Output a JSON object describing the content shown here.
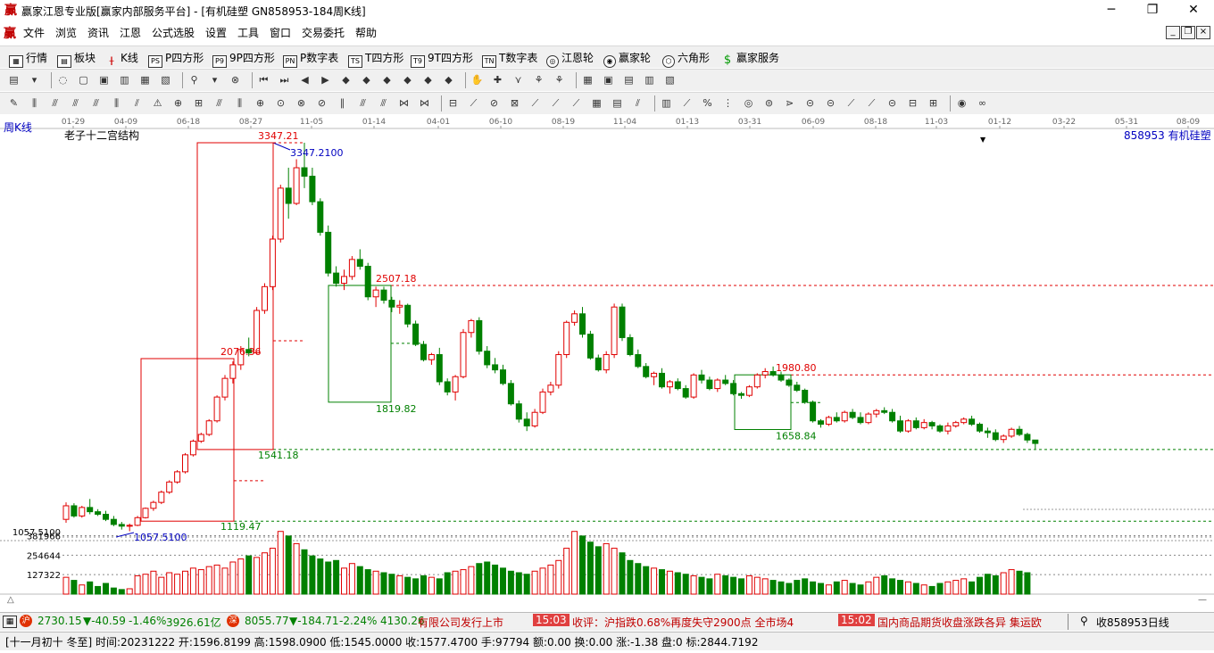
{
  "window": {
    "title": "赢家江恩专业版[赢家内部服务平台] - [有机硅塑   GN858953-184周K线]",
    "app_icon": "赢",
    "controls": [
      "─",
      "❐",
      "✕"
    ]
  },
  "menubar": {
    "logo": "赢",
    "items": [
      "文件",
      "浏览",
      "资讯",
      "江恩",
      "公式选股",
      "设置",
      "工具",
      "窗口",
      "交易委托",
      "帮助"
    ],
    "mdi_controls": [
      "_",
      "❐",
      "×"
    ]
  },
  "toolbar1": {
    "items": [
      {
        "label": "行情",
        "icon": "grid-icon"
      },
      {
        "label": "板块",
        "icon": "blocks-icon"
      },
      {
        "label": "K线",
        "icon": "candle-icon"
      },
      {
        "label": "P四方形",
        "icon": "PS"
      },
      {
        "label": "9P四方形",
        "icon": "P9"
      },
      {
        "label": "P数字表",
        "icon": "PN"
      },
      {
        "label": "T四方形",
        "icon": "TS"
      },
      {
        "label": "9T四方形",
        "icon": "T9"
      },
      {
        "label": "T数字表",
        "icon": "TN"
      },
      {
        "label": "江恩轮",
        "icon": "wheel-icon"
      },
      {
        "label": "赢家轮",
        "icon": "wheel2-icon"
      },
      {
        "label": "六角形",
        "icon": "hexagon-icon"
      },
      {
        "label": "赢家服务",
        "icon": "dollar-icon"
      }
    ]
  },
  "chart": {
    "period_label": "周K线",
    "indicator_name": "老子十二宫结构",
    "code_label": "858953 有机硅塑",
    "dropdown_icon": "▼",
    "date_ticks": [
      "01-29",
      "04-09",
      "06-18",
      "08-27",
      "11-05",
      "01-14",
      "04-01",
      "06-10",
      "08-19",
      "11-04",
      "01-13",
      "03-31",
      "06-09",
      "08-18",
      "11-03",
      "01-12",
      "03-22",
      "05-31",
      "08-09"
    ],
    "price_axis_label": "1057.5100",
    "volume_axis": [
      "381966",
      "254644",
      "127322"
    ],
    "annotations": {
      "high": "3347.21",
      "high_exact": "3347.2100",
      "low_exact": "1057.5100",
      "box1_low": "1119.47",
      "box1_high": "2076.36",
      "level_1541": "1541.18",
      "box2_high": "2507.18",
      "box2_low": "1819.82",
      "box3_high": "1980.80",
      "box3_low": "1658.84"
    },
    "colors": {
      "up": "#e00000",
      "down": "#008000",
      "annot_red": "#e00000",
      "annot_blue": "#0000c0",
      "annot_green": "#008000",
      "dash_red": "#e00000",
      "dash_green": "#008000"
    }
  },
  "chart_data": {
    "type": "candlestick",
    "title": "老子十二宫结构",
    "series_name": "858953 有机硅塑",
    "period": "周K线",
    "x_ticks": [
      "01-29",
      "04-09",
      "06-18",
      "08-27",
      "11-05",
      "01-14",
      "04-01",
      "06-10",
      "08-19",
      "11-04",
      "01-13",
      "03-31",
      "06-09",
      "08-18",
      "11-03",
      "01-12",
      "03-22",
      "05-31",
      "08-09"
    ],
    "ohlc": [
      [
        1130,
        1230,
        1110,
        1210
      ],
      [
        1210,
        1225,
        1140,
        1150
      ],
      [
        1150,
        1210,
        1140,
        1200
      ],
      [
        1200,
        1250,
        1160,
        1175
      ],
      [
        1175,
        1190,
        1150,
        1160
      ],
      [
        1160,
        1180,
        1120,
        1130
      ],
      [
        1130,
        1150,
        1090,
        1100
      ],
      [
        1100,
        1115,
        1070,
        1090
      ],
      [
        1090,
        1105,
        1060,
        1095
      ],
      [
        1095,
        1150,
        1090,
        1140
      ],
      [
        1140,
        1200,
        1135,
        1195
      ],
      [
        1195,
        1240,
        1180,
        1230
      ],
      [
        1230,
        1300,
        1220,
        1290
      ],
      [
        1290,
        1360,
        1280,
        1350
      ],
      [
        1350,
        1420,
        1340,
        1410
      ],
      [
        1410,
        1520,
        1400,
        1510
      ],
      [
        1510,
        1600,
        1500,
        1590
      ],
      [
        1590,
        1640,
        1580,
        1630
      ],
      [
        1630,
        1720,
        1620,
        1710
      ],
      [
        1710,
        1860,
        1700,
        1850
      ],
      [
        1850,
        1980,
        1830,
        1960
      ],
      [
        1960,
        2060,
        1930,
        2040
      ],
      [
        2040,
        2150,
        2010,
        2130
      ],
      [
        2130,
        2200,
        2090,
        2110
      ],
      [
        2110,
        2380,
        2100,
        2360
      ],
      [
        2360,
        2520,
        2340,
        2500
      ],
      [
        2500,
        2800,
        2480,
        2780
      ],
      [
        2780,
        3100,
        2760,
        3080
      ],
      [
        3080,
        3200,
        2900,
        2990
      ],
      [
        2990,
        3250,
        2980,
        3200
      ],
      [
        3200,
        3347,
        3080,
        3150
      ],
      [
        3150,
        3200,
        2980,
        3000
      ],
      [
        3000,
        3020,
        2800,
        2820
      ],
      [
        2820,
        2860,
        2560,
        2580
      ],
      [
        2580,
        2620,
        2500,
        2520
      ],
      [
        2520,
        2600,
        2480,
        2560
      ],
      [
        2560,
        2680,
        2540,
        2660
      ],
      [
        2660,
        2720,
        2600,
        2620
      ],
      [
        2620,
        2640,
        2420,
        2440
      ],
      [
        2440,
        2500,
        2380,
        2480
      ],
      [
        2480,
        2500,
        2400,
        2420
      ],
      [
        2420,
        2440,
        2350,
        2380
      ],
      [
        2380,
        2420,
        2340,
        2390
      ],
      [
        2390,
        2400,
        2260,
        2280
      ],
      [
        2280,
        2300,
        2150,
        2160
      ],
      [
        2160,
        2180,
        2060,
        2070
      ],
      [
        2070,
        2110,
        2040,
        2100
      ],
      [
        2100,
        2140,
        1920,
        1940
      ],
      [
        1940,
        1960,
        1860,
        1880
      ],
      [
        1880,
        1980,
        1830,
        1970
      ],
      [
        1970,
        2250,
        1960,
        2230
      ],
      [
        2230,
        2310,
        2200,
        2300
      ],
      [
        2300,
        2320,
        2100,
        2120
      ],
      [
        2120,
        2150,
        2020,
        2040
      ],
      [
        2040,
        2080,
        1990,
        2010
      ],
      [
        2010,
        2040,
        1920,
        1930
      ],
      [
        1930,
        1950,
        1800,
        1810
      ],
      [
        1810,
        1830,
        1700,
        1720
      ],
      [
        1720,
        1760,
        1650,
        1680
      ],
      [
        1680,
        1780,
        1670,
        1760
      ],
      [
        1760,
        1900,
        1750,
        1880
      ],
      [
        1880,
        1940,
        1860,
        1920
      ],
      [
        1920,
        2120,
        1900,
        2100
      ],
      [
        2100,
        2300,
        2080,
        2290
      ],
      [
        2290,
        2360,
        2270,
        2340
      ],
      [
        2340,
        2380,
        2200,
        2220
      ],
      [
        2220,
        2240,
        2070,
        2080
      ],
      [
        2080,
        2100,
        2000,
        2010
      ],
      [
        2010,
        2120,
        1990,
        2100
      ],
      [
        2100,
        2400,
        2080,
        2380
      ],
      [
        2380,
        2400,
        2180,
        2200
      ],
      [
        2200,
        2220,
        2090,
        2100
      ],
      [
        2100,
        2130,
        2020,
        2030
      ],
      [
        2030,
        2050,
        1960,
        1970
      ],
      [
        1970,
        2000,
        1920,
        1990
      ],
      [
        1990,
        2020,
        1900,
        1910
      ],
      [
        1910,
        1950,
        1870,
        1940
      ],
      [
        1940,
        1960,
        1890,
        1900
      ],
      [
        1900,
        1920,
        1840,
        1850
      ],
      [
        1850,
        1990,
        1840,
        1980
      ],
      [
        1980,
        2010,
        1930,
        1950
      ],
      [
        1950,
        1970,
        1890,
        1900
      ],
      [
        1900,
        1960,
        1880,
        1950
      ],
      [
        1950,
        1980,
        1920,
        1930
      ],
      [
        1930,
        1950,
        1860,
        1870
      ],
      [
        1870,
        1880,
        1840,
        1860
      ],
      [
        1860,
        1920,
        1850,
        1910
      ],
      [
        1910,
        1990,
        1900,
        1980
      ],
      [
        1980,
        2020,
        1960,
        2000
      ],
      [
        2000,
        2030,
        1970,
        1980
      ],
      [
        1980,
        2000,
        1940,
        1950
      ],
      [
        1950,
        1960,
        1910,
        1920
      ],
      [
        1920,
        1940,
        1880,
        1890
      ],
      [
        1890,
        1900,
        1810,
        1820
      ],
      [
        1820,
        1830,
        1700,
        1710
      ],
      [
        1710,
        1720,
        1670,
        1690
      ],
      [
        1690,
        1740,
        1680,
        1730
      ],
      [
        1730,
        1760,
        1700,
        1710
      ],
      [
        1710,
        1770,
        1700,
        1760
      ],
      [
        1760,
        1780,
        1720,
        1730
      ],
      [
        1730,
        1760,
        1690,
        1700
      ],
      [
        1700,
        1760,
        1690,
        1750
      ],
      [
        1750,
        1780,
        1730,
        1770
      ],
      [
        1770,
        1790,
        1750,
        1760
      ],
      [
        1760,
        1780,
        1700,
        1710
      ],
      [
        1710,
        1740,
        1640,
        1650
      ],
      [
        1650,
        1720,
        1640,
        1710
      ],
      [
        1710,
        1730,
        1660,
        1670
      ],
      [
        1670,
        1720,
        1660,
        1700
      ],
      [
        1700,
        1710,
        1660,
        1680
      ],
      [
        1680,
        1690,
        1640,
        1650
      ],
      [
        1650,
        1700,
        1630,
        1680
      ],
      [
        1680,
        1710,
        1670,
        1700
      ],
      [
        1700,
        1730,
        1690,
        1720
      ],
      [
        1720,
        1740,
        1680,
        1690
      ],
      [
        1690,
        1700,
        1640,
        1650
      ],
      [
        1650,
        1670,
        1610,
        1640
      ],
      [
        1640,
        1660,
        1590,
        1600
      ],
      [
        1600,
        1630,
        1580,
        1620
      ],
      [
        1620,
        1670,
        1610,
        1660
      ],
      [
        1660,
        1680,
        1620,
        1630
      ],
      [
        1630,
        1640,
        1580,
        1597
      ],
      [
        1597,
        1598,
        1545,
        1577
      ]
    ],
    "volume": [
      110000,
      90000,
      60000,
      80000,
      50000,
      70000,
      40000,
      30000,
      35000,
      120000,
      130000,
      150000,
      110000,
      140000,
      130000,
      150000,
      170000,
      160000,
      180000,
      190000,
      170000,
      210000,
      230000,
      250000,
      240000,
      270000,
      300000,
      410000,
      380000,
      330000,
      290000,
      250000,
      230000,
      210000,
      220000,
      170000,
      200000,
      180000,
      160000,
      150000,
      140000,
      130000,
      120000,
      110000,
      100000,
      120000,
      110000,
      100000,
      140000,
      150000,
      160000,
      180000,
      200000,
      210000,
      190000,
      170000,
      150000,
      140000,
      130000,
      150000,
      170000,
      190000,
      220000,
      300000,
      410000,
      380000,
      340000,
      310000,
      330000,
      300000,
      270000,
      220000,
      200000,
      180000,
      170000,
      160000,
      150000,
      140000,
      130000,
      120000,
      110000,
      100000,
      130000,
      120000,
      110000,
      100000,
      120000,
      110000,
      100000,
      90000,
      80000,
      70000,
      90000,
      100000,
      80000,
      70000,
      60000,
      80000,
      90000,
      70000,
      60000,
      80000,
      110000,
      120000,
      100000,
      90000,
      80000,
      70000,
      60000,
      50000,
      70000,
      80000,
      90000,
      100000,
      80000,
      110000,
      130000,
      120000,
      140000,
      160000,
      150000,
      140000
    ],
    "price_axis_label": "1057.5100",
    "volume_ticks": [
      "381966",
      "254644",
      "127322"
    ],
    "annotations": [
      "3347.21",
      "3347.2100",
      "1057.5100",
      "1119.47",
      "2076.36",
      "1541.18",
      "2507.18",
      "1819.82",
      "1980.80",
      "1658.84"
    ],
    "ylim": [
      1000,
      3400
    ]
  },
  "status": {
    "sh_value": "2730.15",
    "sh_change": "▼-40.59",
    "sh_pct": "-1.46%",
    "sh_amount": "3926.61亿",
    "sz_value": "8055.77",
    "sz_change": "▼-184.71",
    "sz_pct": "-2.24%",
    "sz_amount": "4130.26",
    "ticker_text": "有限公司发行上市",
    "time1": "15:03",
    "news1": "收评：沪指跌0.68%再度失守2900点 全市场4",
    "time2": "15:02",
    "news2": "国内商品期货收盘涨跌各异 集运欧",
    "alert_label": "收858953日线"
  },
  "bottom_info": {
    "text": "[十一月初十 冬至] 时间:20231222 开:1596.8199 高:1598.0900 低:1545.0000 收:1577.4700 手:97794 额:0.00 换:0.00 涨:-1.38 盘:0 标:2844.7192"
  }
}
